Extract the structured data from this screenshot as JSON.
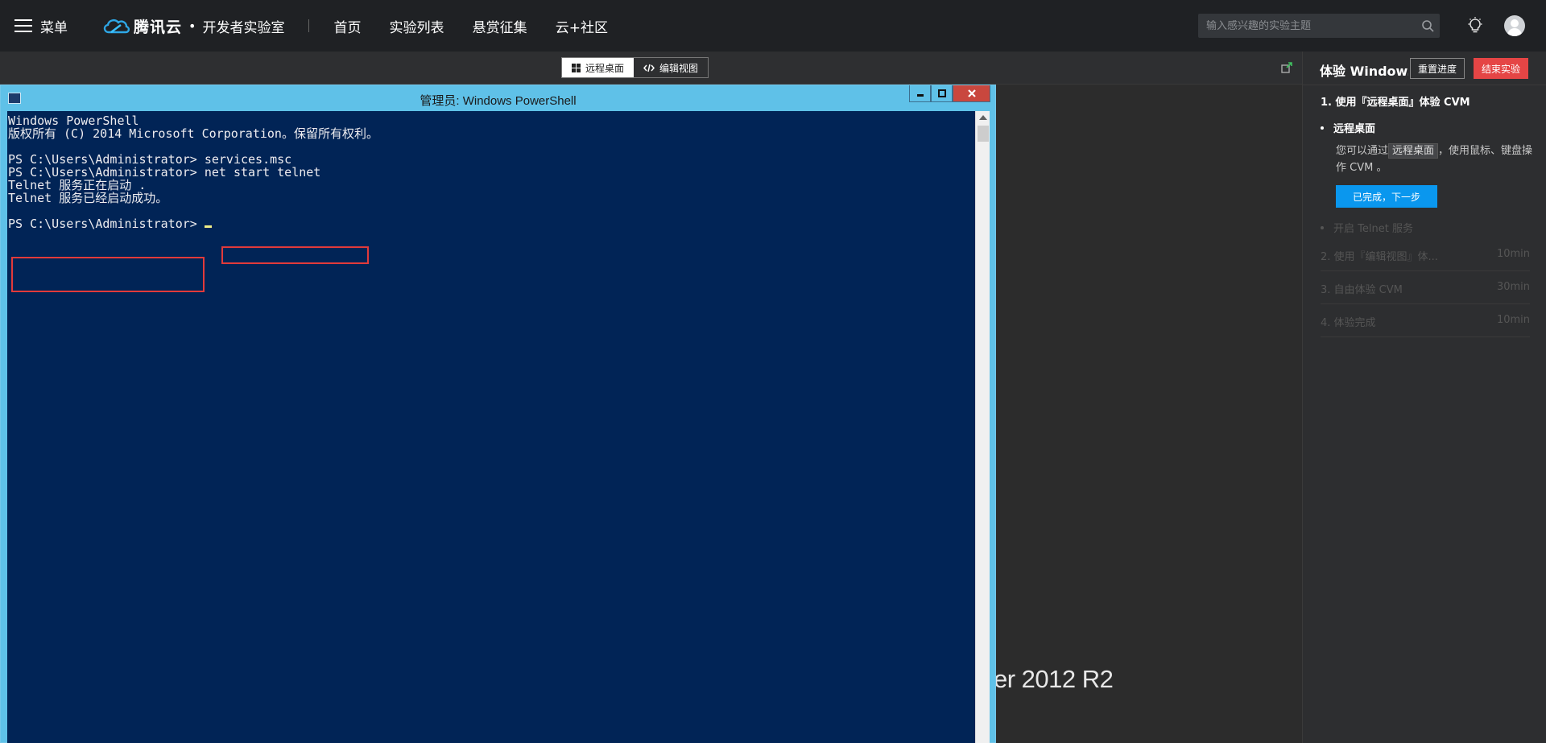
{
  "topbar": {
    "menu_label": "菜单",
    "brand_name": "腾讯云",
    "brand_sep": "•",
    "brand_sub": "开发者实验室",
    "nav": [
      "首页",
      "实验列表",
      "悬赏征集",
      "云+社区"
    ],
    "search_placeholder": "输入感兴趣的实验主题"
  },
  "toolbar": {
    "remote_label": "远程桌面",
    "editor_label": "编辑视图"
  },
  "window": {
    "title": "管理员: Windows PowerShell",
    "console_lines": [
      "Windows PowerShell",
      "版权所有 (C) 2014 Microsoft Corporation。保留所有权利。",
      "",
      "PS C:\\Users\\Administrator> services.msc",
      "PS C:\\Users\\Administrator> net start telnet",
      "Telnet 服务正在启动 .",
      "Telnet 服务已经启动成功。",
      "",
      "PS C:\\Users\\Administrator> "
    ]
  },
  "desktop": {
    "os_watermark": "er 2012 R2"
  },
  "sidebar": {
    "title": "体验 Window...",
    "reset_label": "重置进度",
    "end_label": "结束实验",
    "current_step": "1. 使用『远程桌面』体验 CVM",
    "current_substep": "远程桌面",
    "desc_before": "您可以通过",
    "desc_tag": "远程桌面",
    "desc_after": "，使用鼠标、键盘操作 CVM 。",
    "next_label": "已完成，下一步",
    "next_substep": "开启 Telnet 服务",
    "steps": [
      {
        "name": "2. 使用『编辑视图』体...",
        "time": "10min"
      },
      {
        "name": "3. 自由体验 CVM",
        "time": "30min"
      },
      {
        "name": "4. 体验完成",
        "time": "10min"
      }
    ]
  },
  "colors": {
    "console_bg": "#012456",
    "window_frame": "#5fc1e8",
    "highlight": "#e23a3a",
    "accent_blue": "#0a97ee",
    "danger": "#e54545"
  }
}
